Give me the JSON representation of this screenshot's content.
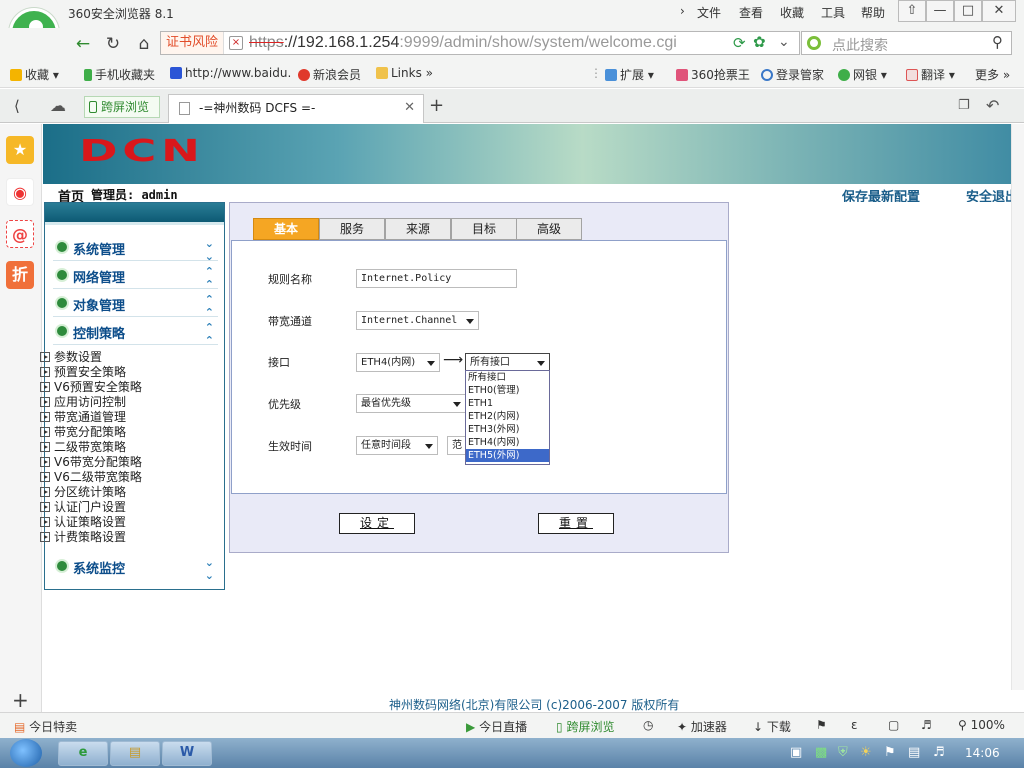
{
  "browser": {
    "app_title": "360安全浏览器 8.1",
    "menu": [
      "文件",
      "查看",
      "收藏",
      "工具",
      "帮助"
    ],
    "cert_warning": "证书风险",
    "url_scheme": "https",
    "url_host": "://192.168.1.254",
    "url_rest": ":9999/admin/show/system/welcome.cgi",
    "search_placeholder": "点此搜索",
    "bookmarks": [
      "收藏",
      "手机收藏夹",
      "http://www.baidu.",
      "新浪会员",
      "Links"
    ],
    "extensions": [
      "扩展",
      "360抢票王",
      "登录管家",
      "网银",
      "翻译",
      "更多"
    ],
    "tab_splitscreen": "跨屏浏览",
    "tab_active_title": "-=神州数码 DCFS =-",
    "status_left": "今日特卖",
    "status_items": [
      "今日直播",
      "跨屏浏览",
      "加速器",
      "下载",
      "100%"
    ],
    "clock": "14:06"
  },
  "page": {
    "logo_text": "DCN",
    "home": "首页",
    "admin_label": "管理员: admin",
    "save_config": "保存最新配置",
    "logout": "安全退出",
    "footer": "神州数码网络(北京)有限公司 (c)2006-2007 版权所有"
  },
  "menu": {
    "categories": [
      "系统管理",
      "网络管理",
      "对象管理",
      "控制策略",
      "系统监控"
    ],
    "sub_items": [
      "参数设置",
      "预置安全策略",
      "V6预置安全策略",
      "应用访问控制",
      "带宽通道管理",
      "带宽分配策略",
      "二级带宽策略",
      "V6带宽分配策略",
      "V6二级带宽策略",
      "分区统计策略",
      "认证门户设置",
      "认证策略设置",
      "计费策略设置"
    ]
  },
  "form": {
    "tabs": [
      "基本",
      "服务",
      "来源",
      "目标",
      "高级"
    ],
    "labels": {
      "rule_name": "规则名称",
      "channel": "带宽通道",
      "interface": "接口",
      "priority": "优先级",
      "time": "生效时间"
    },
    "rule_name_value": "Internet.Policy",
    "channel_value": "Internet.Channel",
    "interface_from": "ETH4(内网)",
    "interface_to": "所有接口",
    "priority_value": "最省优先级",
    "time_value": "任意时间段",
    "time_extra": "范",
    "interface_options": [
      "所有接口",
      "ETH0(管理)",
      "ETH1",
      "ETH2(内网)",
      "ETH3(外网)",
      "ETH4(内网)",
      "ETH5(外网)"
    ],
    "highlighted_option": "ETH5(外网)",
    "submit_label": "设定",
    "reset_label": "重置"
  }
}
